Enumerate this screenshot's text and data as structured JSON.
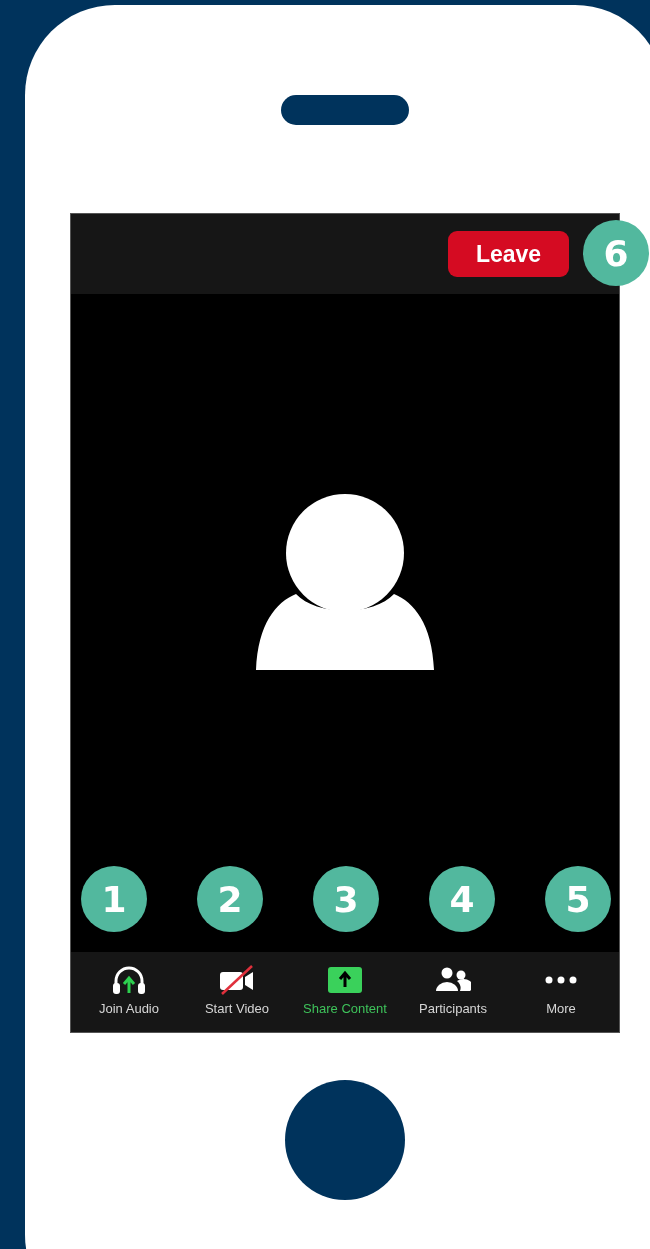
{
  "top_bar": {
    "leave_button": "Leave"
  },
  "toolbar": [
    {
      "kind": "audio",
      "label": "Join Audio",
      "selected": false
    },
    {
      "kind": "video",
      "label": "Start Video",
      "selected": false
    },
    {
      "kind": "share",
      "label": "Share Content",
      "selected": true
    },
    {
      "kind": "participants",
      "label": "Participants",
      "selected": false
    },
    {
      "kind": "more",
      "label": "More",
      "selected": false
    }
  ],
  "callouts": [
    "1",
    "2",
    "3",
    "4",
    "5",
    "6"
  ]
}
